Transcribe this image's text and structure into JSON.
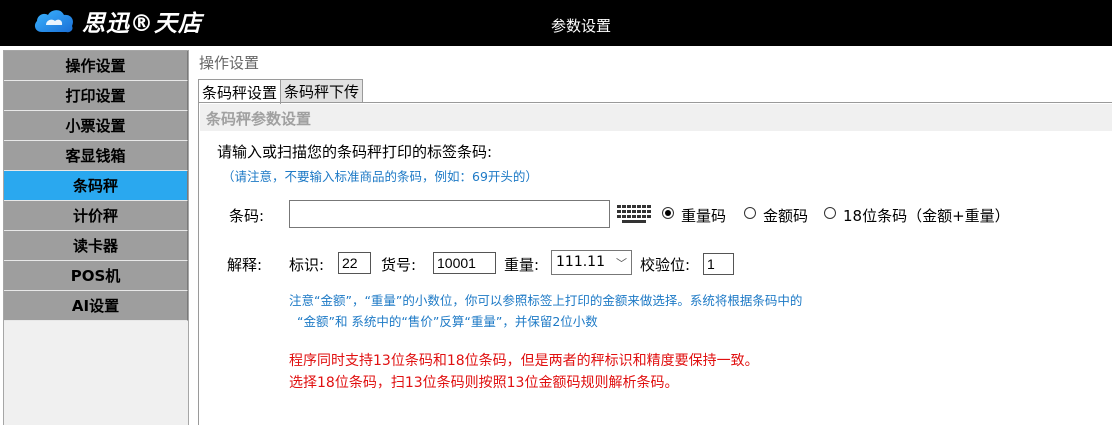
{
  "header": {
    "logo_text": "思迅®天店",
    "title": "参数设置"
  },
  "sidebar": {
    "items": [
      {
        "label": "操作设置"
      },
      {
        "label": "打印设置"
      },
      {
        "label": "小票设置"
      },
      {
        "label": "客显钱箱"
      },
      {
        "label": "条码秤"
      },
      {
        "label": "计价秤"
      },
      {
        "label": "读卡器"
      },
      {
        "label": "POS机"
      },
      {
        "label": "AI设置"
      }
    ],
    "active_index": 4
  },
  "main": {
    "title": "操作设置",
    "tabs": [
      {
        "label": "条码秤设置"
      },
      {
        "label": "条码秤下传"
      }
    ],
    "panel_title": "条码秤参数设置",
    "instruction": "请输入或扫描您的条码秤打印的标签条码:",
    "hint": "（请注意，不要输入标准商品的条码，例如：69开头的）",
    "barcode": {
      "label": "条码:",
      "value": "",
      "keyboard_icon": "keyboard-icon"
    },
    "radios": [
      {
        "label": "重量码",
        "checked": true
      },
      {
        "label": "金额码",
        "checked": false
      },
      {
        "label": "18位条码（金额+重量）",
        "checked": false
      }
    ],
    "explain": {
      "label": "解释:",
      "id_label": "标识:",
      "id_value": "22",
      "goods_label": "货号:",
      "goods_value": "10001",
      "weight_label": "重量:",
      "weight_value": "111.11",
      "check_label": "校验位:",
      "check_value": "1"
    },
    "note_line1": "注意“金额”，“重量”的小数位，你可以参照标签上打印的金额来做选择。系统将根据条码中的",
    "note_line2": "“金额”和 系统中的“售价”反算“重量”，并保留2位小数",
    "warning_line1": "程序同时支持13位条码和18位条码，但是两者的秤标识和精度要保持一致。",
    "warning_line2": "选择18位条码，扫13位条码则按照13位金额码规则解析条码。"
  },
  "colors": {
    "topbar": "#000000",
    "sidebar_item": "#9e9e9e",
    "sidebar_active": "#2aa8ef",
    "note_blue": "#1e7ac6",
    "warning_red": "#e01010"
  }
}
